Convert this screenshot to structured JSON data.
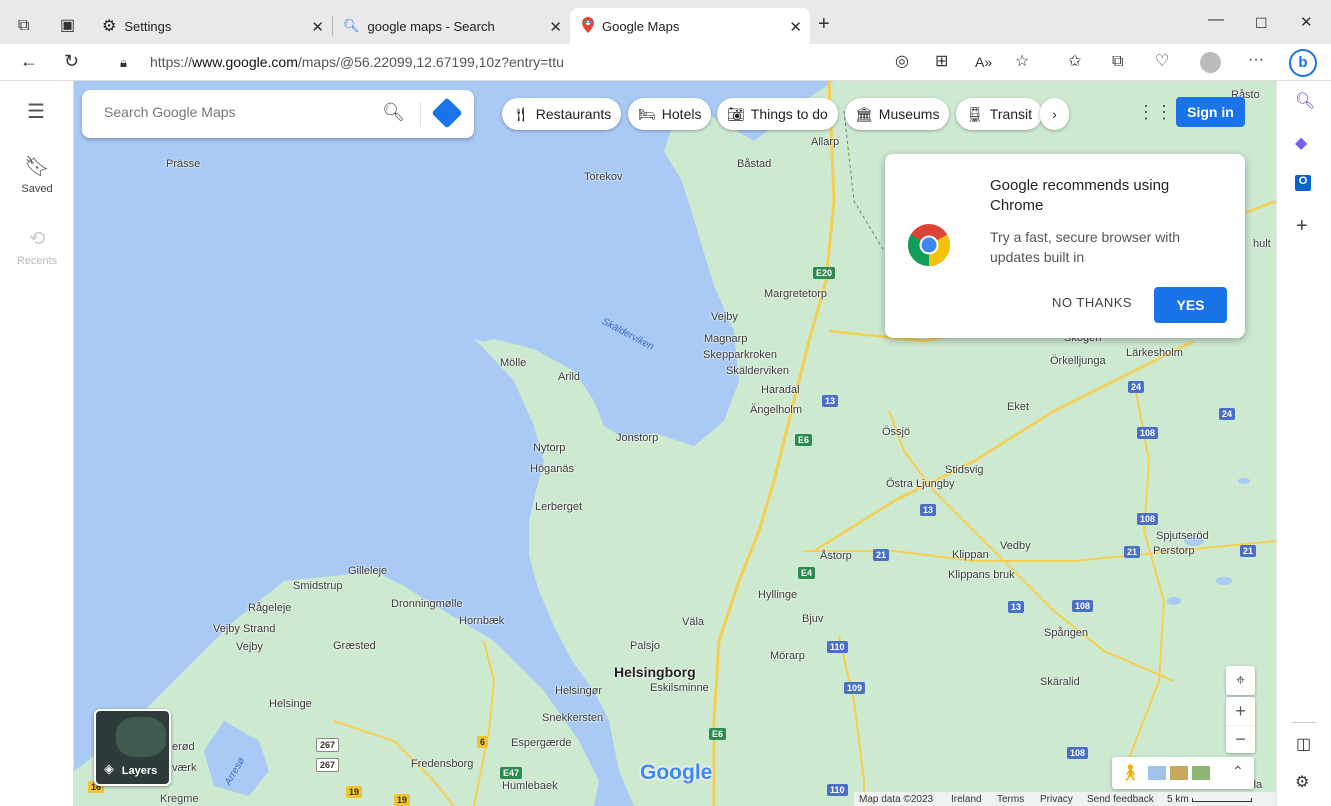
{
  "browser": {
    "tabs": [
      {
        "title": "Settings",
        "icon": "gear-icon"
      },
      {
        "title": "google maps - Search",
        "icon": "search-icon"
      },
      {
        "title": "Google Maps",
        "icon": "maps-pin-icon"
      }
    ],
    "url_prefix": "https://",
    "url_host": "www.google.com",
    "url_path": "/maps/@56.22099,12.67199,10z?entry=ttu"
  },
  "rail": {
    "saved_label": "Saved",
    "recents_label": "Recents"
  },
  "search": {
    "placeholder": "Search Google Maps"
  },
  "chips": [
    "Restaurants",
    "Hotels",
    "Things to do",
    "Museums",
    "Transit"
  ],
  "signin_label": "Sign in",
  "promo": {
    "title": "Google recommends using Chrome",
    "subtitle": "Try a fast, secure browser with updates built in",
    "no_label": "NO THANKS",
    "yes_label": "YES"
  },
  "layers_label": "Layers",
  "google_logo": "Google",
  "footer": {
    "map_data": "Map data ©2023",
    "country": "Ireland",
    "terms": "Terms",
    "privacy": "Privacy",
    "feedback": "Send feedback",
    "scale": "5 km"
  },
  "places": {
    "prasse": "Prässe",
    "torekov": "Torekov",
    "bastad": "Båstad",
    "allarp": "Allarp",
    "rasto": "Råsto",
    "margretetorp": "Margretetorp",
    "vejby": "Vejby",
    "magnarp": "Magnarp",
    "skepparkroken": "Skepparkroken",
    "skalderviken": "Skälderviken",
    "molle": "Mölle",
    "arild": "Arild",
    "haradal": "Haradal",
    "angelholm": "Ängelholm",
    "jonstorp": "Jonstorp",
    "nytorp": "Nytorp",
    "hoganas": "Höganäs",
    "lerberget": "Lerberget",
    "ossjo": "Össjö",
    "stidsvig": "Stidsvig",
    "ostra_ljungby": "Östra Ljungby",
    "astorp": "Åstorp",
    "klippan": "Klippan",
    "klippans_bruk": "Klippans bruk",
    "vedby": "Vedby",
    "spjutserod": "Spjutseröd",
    "perstorp": "Perstorp",
    "hyllinge": "Hyllinge",
    "bjuv": "Bjuv",
    "vala": "Väla",
    "palsjo": "Palsjo",
    "helsingborg": "Helsingborg",
    "morarp": "Mörarp",
    "eskilsminne": "Eskilsminne",
    "spangen": "Spången",
    "skaralid": "Skäralid",
    "skogen": "Skogen",
    "orkelljunga": "Örkelljunga",
    "larkesholm": "Lärkesholm",
    "eket": "Eket",
    "gilleleje": "Gilleleje",
    "smidstrup": "Smidstrup",
    "dronningmolle": "Dronningmølle",
    "rageleje": "Rågeleje",
    "hornbaek": "Hornbæk",
    "vejby_strand": "Vejby Strand",
    "vejby2": "Vejby",
    "graested": "Græsted",
    "helsinge": "Helsinge",
    "helsingor": "Helsingør",
    "snekkersten": "Snekkersten",
    "espergaerde": "Espergærde",
    "fredensborg": "Fredensborg",
    "humlebaek": "Humlebaek",
    "kregme": "Kregme",
    "vaerk": "værk",
    "erod": "erød",
    "hult": "hult",
    "arreso": "Arresø",
    "julia": "Jula",
    "skald_water": "Skälderviken"
  },
  "roads": {
    "e20": "E20",
    "e6a": "E6",
    "e6b": "E6",
    "e4": "E4",
    "r13a": "13",
    "r13b": "13",
    "r13c": "13",
    "r21a": "21",
    "r21b": "21",
    "r21c": "21",
    "r24a": "24",
    "r24b": "24",
    "r108a": "108",
    "r108b": "108",
    "r108c": "108",
    "r108d": "108",
    "r110a": "110",
    "r110b": "110",
    "r109": "109",
    "r267a": "267",
    "r267b": "267",
    "r6": "6",
    "e47": "E47",
    "r19a": "19",
    "r19b": "19",
    "r16": "16"
  }
}
